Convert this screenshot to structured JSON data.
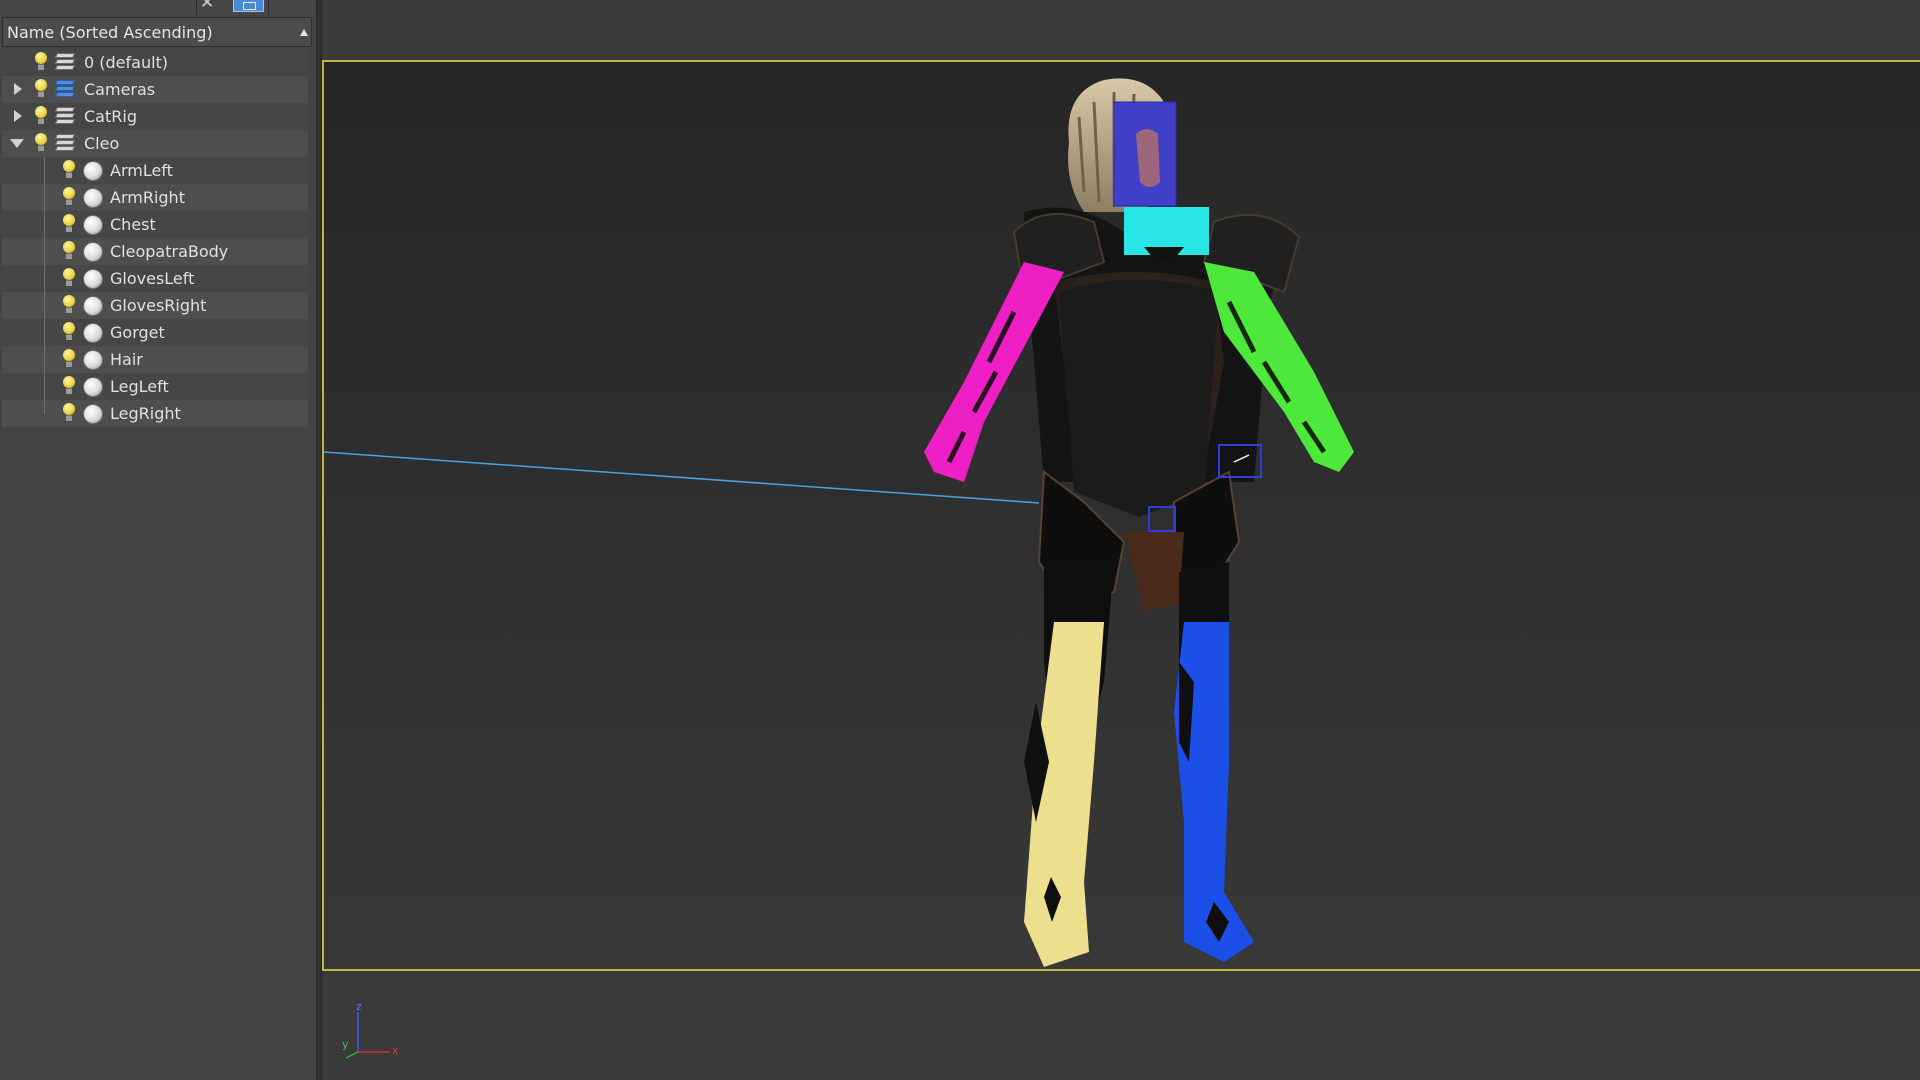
{
  "explorer": {
    "column_header": "Name (Sorted Ascending)",
    "items": [
      {
        "label": "0 (default)",
        "kind": "layer",
        "expander": "none",
        "active": false,
        "icon": "layer-stack-icon"
      },
      {
        "label": "Cameras",
        "kind": "layer",
        "expander": "closed",
        "active": true,
        "icon": "layer-stack-icon"
      },
      {
        "label": "CatRig",
        "kind": "layer",
        "expander": "closed",
        "active": false,
        "icon": "layer-stack-icon"
      },
      {
        "label": "Cleo",
        "kind": "layer",
        "expander": "open",
        "active": false,
        "icon": "layer-stack-icon"
      },
      {
        "label": "ArmLeft",
        "kind": "object",
        "icon": "sphere-object-icon"
      },
      {
        "label": "ArmRight",
        "kind": "object",
        "icon": "sphere-object-icon"
      },
      {
        "label": "Chest",
        "kind": "object",
        "icon": "sphere-object-icon"
      },
      {
        "label": "CleopatraBody",
        "kind": "object",
        "icon": "sphere-object-icon"
      },
      {
        "label": "GlovesLeft",
        "kind": "object",
        "icon": "sphere-object-icon"
      },
      {
        "label": "GlovesRight",
        "kind": "object",
        "icon": "sphere-object-icon"
      },
      {
        "label": "Gorget",
        "kind": "object",
        "icon": "sphere-object-icon"
      },
      {
        "label": "Hair",
        "kind": "object",
        "icon": "sphere-object-icon"
      },
      {
        "label": "LegLeft",
        "kind": "object",
        "icon": "sphere-object-icon"
      },
      {
        "label": "LegRight",
        "kind": "object",
        "icon": "sphere-object-icon"
      }
    ]
  },
  "viewport": {
    "frame_color": "#c3b63a",
    "part_colors": {
      "head_box": "#3f3fc8",
      "gorget": "#28e6e6",
      "arm_right": "#ee1fc4",
      "arm_left": "#4ee83c",
      "leg_right": "#ecdf8e",
      "leg_left": "#1c4fe8"
    },
    "axis": {
      "z": "z",
      "y": "y",
      "x": "x"
    }
  }
}
